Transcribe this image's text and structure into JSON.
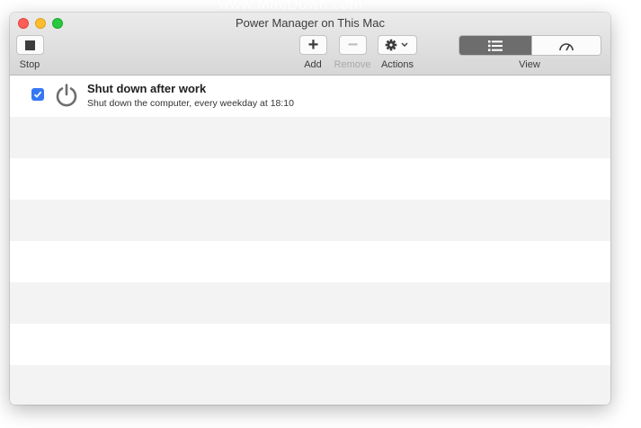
{
  "watermark": "www.MacDown.com",
  "window": {
    "title": "Power Manager on This Mac"
  },
  "toolbar": {
    "stop_label": "Stop",
    "add_label": "Add",
    "remove_label": "Remove",
    "actions_label": "Actions",
    "view_label": "View",
    "view_selected": "list"
  },
  "events": [
    {
      "enabled": true,
      "title": "Shut down after work",
      "subtitle": "Shut down the computer, every weekday at 18:10",
      "icon": "power-icon"
    }
  ],
  "colors": {
    "accent": "#3478f6",
    "close": "#fd5f57",
    "minimize": "#febc2e",
    "zoom": "#28c840"
  }
}
